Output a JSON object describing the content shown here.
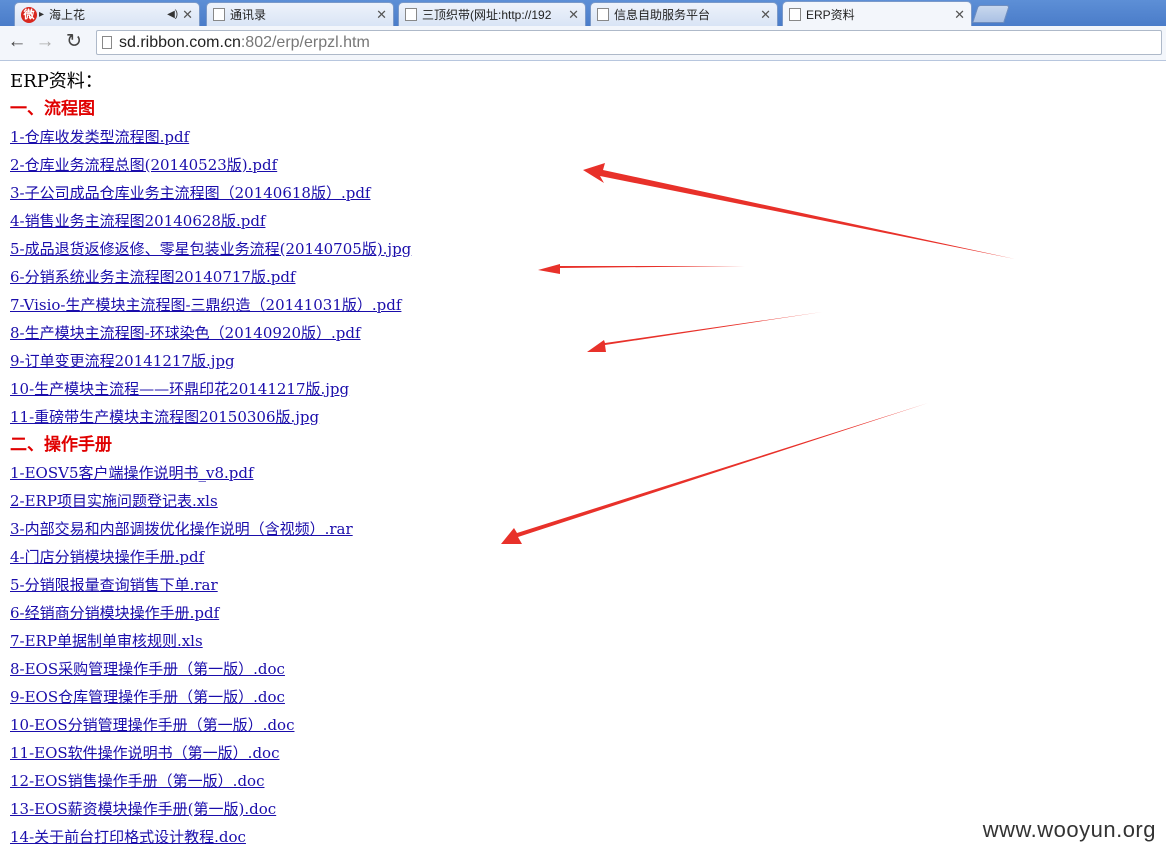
{
  "tabs": [
    {
      "title": "海上花",
      "icon": "weibo-icon",
      "icon_text": "微"
    },
    {
      "title": "通讯录",
      "icon": "page-icon"
    },
    {
      "title": "三顶织带(网址:http://192",
      "icon": "page-icon"
    },
    {
      "title": "信息自助服务平台",
      "icon": "page-icon"
    },
    {
      "title": "ERP资料",
      "icon": "page-icon"
    }
  ],
  "nav": {
    "back": "←",
    "forward": "→",
    "reload": "↻"
  },
  "address": {
    "host": "sd.ribbon.com.cn",
    "path": ":802/erp/erpzl.htm"
  },
  "page": {
    "title": "ERP资料：",
    "sections": [
      {
        "heading": "一、流程图",
        "links": [
          "1-仓库收发类型流程图.pdf",
          "2-仓库业务流程总图(20140523版).pdf",
          "3-子公司成品仓库业务主流程图（20140618版）.pdf",
          "4-销售业务主流程图20140628版.pdf",
          "5-成品退货返修返修、零星包装业务流程(20140705版).jpg",
          "6-分销系统业务主流程图20140717版.pdf",
          "7-Visio-生产模块主流程图-三鼎织造（20141031版）.pdf",
          "8-生产模块主流程图-环球染色（20140920版）.pdf",
          "9-订单变更流程20141217版.jpg",
          "10-生产模块主流程——环鼎印花20141217版.jpg",
          "11-重磅带生产模块主流程图20150306版.jpg"
        ]
      },
      {
        "heading": "二、操作手册",
        "links": [
          "1-EOSV5客户端操作说明书_v8.pdf",
          "2-ERP项目实施问题登记表.xls",
          "3-内部交易和内部调拨优化操作说明（含视频）.rar",
          "4-门店分销模块操作手册.pdf",
          "5-分销限报量查询销售下单.rar",
          "6-经销商分销模块操作手册.pdf",
          "7-ERP单据制单审核规则.xls",
          "8-EOS采购管理操作手册（第一版）.doc",
          "9-EOS仓库管理操作手册（第一版）.doc",
          "10-EOS分销管理操作手册（第一版）.doc",
          "11-EOS软件操作说明书（第一版）.doc",
          "12-EOS销售操作手册（第一版）.doc",
          "13-EOS薪资模块操作手册(第一版).doc",
          "14-关于前台打印格式设计教程.doc"
        ]
      }
    ]
  },
  "watermark": "www.wooyun.org",
  "colors": {
    "heading": "#e00000",
    "link": "#1a0dab",
    "arrow": "#e8312a"
  }
}
